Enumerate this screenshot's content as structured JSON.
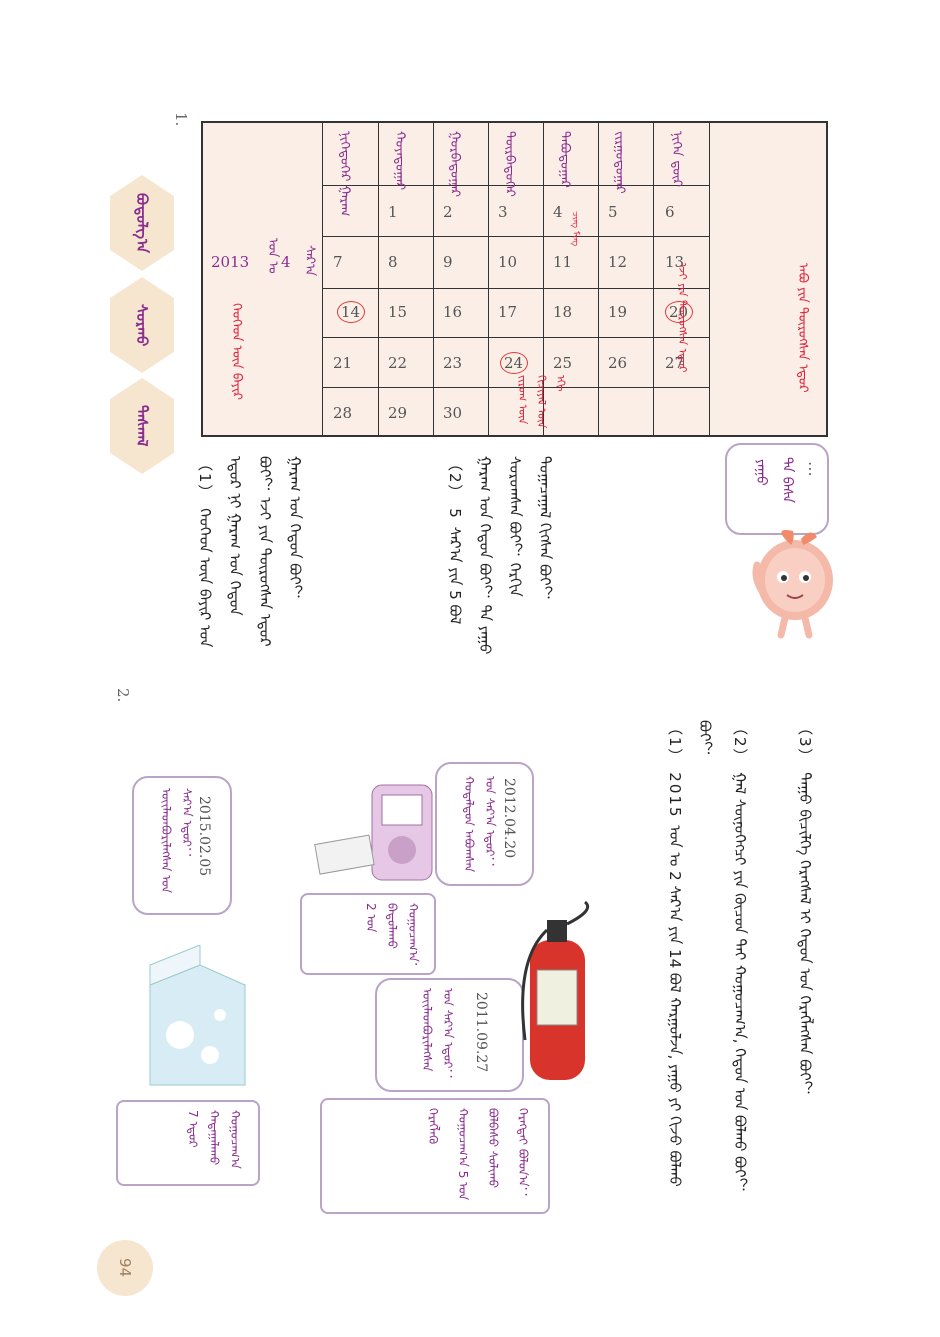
{
  "page": {
    "number": "94",
    "section1_no": "1.",
    "section2_no": "2."
  },
  "tabs": [
    "ᠪᠣᠳᠣᠯᠭ᠎ᠠ",
    "ᠰᠤᠷᠬᠤ",
    "ᠳᠠᠰᠬᠠᠯ"
  ],
  "calendar": {
    "year": "2013",
    "year_suffix": "ᠣᠨ ᠤ",
    "month": "4",
    "month_suffix": "ᠰᠠᠷ᠎ᠠ",
    "weekdays": [
      "ᠨᠢᠭᠡᠳᠦᠭᠡᠷ ᠭᠠᠷᠠᠭ",
      "ᠬᠣᠶᠠᠳᠤᠭᠠᠷ",
      "ᠭᠤᠷᠪᠠᠳᠤᠭᠠᠷ",
      "ᠳᠥᠷᠪᠡᠳᠦᠭᠡᠷ",
      "ᠲᠠᠪᠤᠳᠤᠭᠠᠷ",
      "ᠵᠢᠷᠭᠤᠳᠤᠭᠠᠷ",
      "ᠨᠢᠭᠡᠨ ᠳ᠋ᠦᠷ"
    ],
    "days": [
      [
        "",
        "1",
        "2",
        "3",
        "4",
        "5",
        "6"
      ],
      [
        "7",
        "8",
        "9",
        "10",
        "11",
        "12",
        "13"
      ],
      [
        "14",
        "15",
        "16",
        "17",
        "18",
        "19",
        "20"
      ],
      [
        "21",
        "22",
        "23",
        "24",
        "25",
        "26",
        "27"
      ],
      [
        "28",
        "29",
        "30",
        "",
        "",
        "",
        ""
      ]
    ],
    "circled": [
      "14",
      "20",
      "24"
    ],
    "annotations": {
      "d4": "ᠴᠢᠩ ᠮᠢᠩ",
      "d14": "ᠬᠡᠦᠬᠡᠳ ᠦᠨ ᠪᠠᠶᠢᠷ",
      "d20": "ᠡᠵᠢ ᠶᠢᠨ ᠲᠥᠷᠦᠭᠰᠡᠨ ᠡᠳᠦᠷ",
      "d24": "ᠵᠢᠷᠤᠭ ᠦᠨ ᠬᠢᠴᠢᠶᠡᠯ ᠦᠨ ᠡᠬᠢ",
      "right": "ᠠᠪᠤ ᠶᠢᠨ ᠲᠥᠷᠦᠭᠰᠡᠨ ᠡᠳᠦᠷ"
    }
  },
  "speech": {
    "dots": "⋯",
    "line1": "ᠲᠠ ᠪᠠᠰᠠ",
    "line2": "ᠶᠠᠭᠤ"
  },
  "questions1": [
    "（1） ᠬᠡᠦᠬᠡᠳ ᠦᠨ ᠪᠠᠶᠢᠷ ᠤᠨ ᠡᠳᠦᠷ ᠨᠢ ᠭᠠᠷᠠᠭ ᠤᠨ ᠬᠡᠳᠦᠨ ᠪᠤᠢ？ ᠡᠵᠢ ᠶᠢᠨ ᠲᠥᠷᠦᠭᠰᠡᠨ ᠡᠳᠦᠷ ᠭᠠᠷᠠᠭ ᠤᠨ ᠬᠡᠳᠦᠨ ᠪᠤᠢ？",
    "（2） 5 ᠰᠠᠷ᠎ᠠ ᠶᠢᠨ 5 ᠪᠣᠯ ᠭᠠᠷᠠᠭ ᠤᠨ ᠬᠡᠳᠦᠨ ᠪᠤᠢ？ ᠲᠠ ᠶᠠᠭᠤ ᠰᠤᠷᠤᠭᠰᠠᠨ ᠪᠤᠢ？ ᠬᠡᠷᠬᠢᠨ ᠲᠣᠭᠠᠴᠠᠭᠠᠯ ᠬᠢᠭᠰᠡᠨ ᠪᠤᠢ？"
  ],
  "questions2": [
    "（1） 2015 ᠣᠨ ᠤ 2 ᠰᠠᠷ᠎ᠠ ᠶᠢᠨ 14 ᠪᠣᠯ ᠬᠠᠷᠭᠤᠯᠵᠠ, ᠶᠠᠭᠤ ᠶᠢ ᠬᠢᠵᠦ ᠪᠣᠯᠬᠤ ᠪᠤᠢ？",
    "（2） ᠭᠠᠯ ᠰᠥᠨᠦᠭᠡᠭᠴᠢ ᠶᠢᠨ ᠬᠦᠴᠦᠨ ᠲᠠᠢ ᠬᠤᠭᠤᠴᠠᠭ᠎ᠠ, ᠬᠡᠳᠦᠨ ᠣᠨ ᠪᠣᠯᠬᠤ ᠪᠤᠢ？",
    "（3） ᠳᠠᠭᠤ ᠪᠢᠴᠢᠯᠭᠡ ᠬᠡᠷᠡᠭᠰᠡᠯ ᠢ ᠬᠡᠳᠦᠨ ᠣᠨ ᠬᠡᠷᠡᠭᠯᠡᠭᠰᠡᠨ ᠪᠤᠢ？"
  ],
  "items": {
    "milk": {
      "date": "2015.02.05",
      "label": "ᠦᠢᠯᠡᠳᠪᠦᠷᠢᠯᠡᠭᠰᠡᠨ ᠣᠨ ᠰᠠᠷ᠎ᠠ ᠡᠳᠦᠷ：",
      "note": "7 ᠡᠳᠦᠷ ᠬᠠᠳᠠᠭᠠᠯᠠᠬᠤ ᠬᠤᠭᠤᠴᠠᠭ᠎ᠠ"
    },
    "recorder": {
      "date": "2012.04.20",
      "label": "ᠬᠤᠳᠠᠯᠳᠤᠨ ᠠᠪᠤᠭᠰᠠᠨ ᠣᠨ ᠰᠠᠷ᠎ᠠ ᠡᠳᠦᠷ：",
      "note": "2 ᠣᠨ ᠪᠠᠲᠤᠯᠠᠬᠤ ᠬᠤᠭᠤᠴᠠᠭ᠎ᠠ："
    },
    "extinguisher": {
      "date": "2011.09.27",
      "label": "ᠦᠢᠯᠡᠳᠪᠦᠷᠢᠯᠡᠭᠰᠡᠨ ᠣᠨ ᠰᠠᠷ᠎ᠠ ᠡᠳᠦᠷ：",
      "note": "ᠬᠡᠷᠡᠭᠯᠡᠬᠦ ᠬᠤᠭᠤᠴᠠᠭ᠎ᠠ 5 ᠣᠨ ᠪᠣᠯᠪᠠᠰᠤ ᠰᠣᠯᠢᠬᠤ ᠬᠡᠷᠡᠭᠲᠡᠢ ᠪᠣᠯᠤᠨ᠎ᠠ："
    }
  }
}
